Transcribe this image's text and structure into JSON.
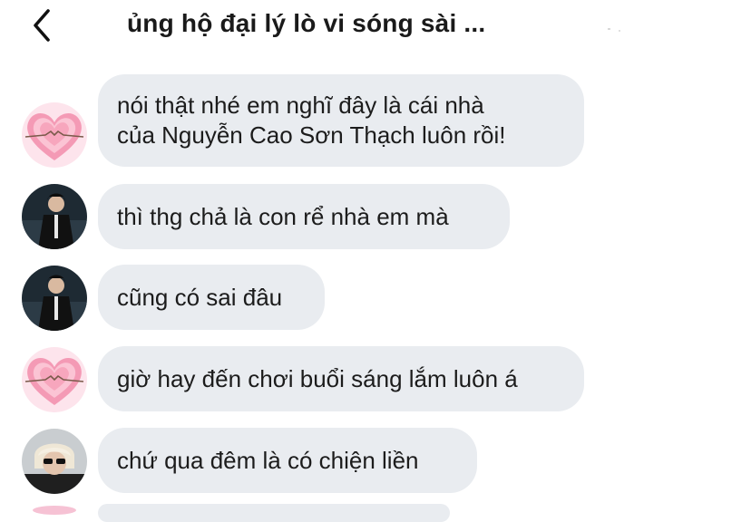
{
  "header": {
    "back_icon": "chevron-left-icon",
    "title": "ủng hộ đại lý lò vi sóng sài ..."
  },
  "messages": [
    {
      "avatar": "heart-hands-avatar",
      "text": "nói thật nhé em nghĩ đây là cái nhà\ncủa Nguyễn Cao Sơn Thạch luôn rồi!"
    },
    {
      "avatar": "man-in-suit-avatar",
      "text": "thì thg chả là con rể nhà em mà"
    },
    {
      "avatar": "man-in-suit-avatar",
      "text": "cũng có sai đâu"
    },
    {
      "avatar": "heart-hands-avatar",
      "text": "giờ hay đến chơi buổi sáng lắm luôn á"
    },
    {
      "avatar": "blonde-person-avatar",
      "text": "chứ qua đêm là có chiện liền"
    }
  ],
  "colors": {
    "bubble_bg": "#e9ecf0",
    "text": "#1c1c1c",
    "heart_pink": "#f08aa8",
    "heart_bg": "#fbd3df"
  }
}
